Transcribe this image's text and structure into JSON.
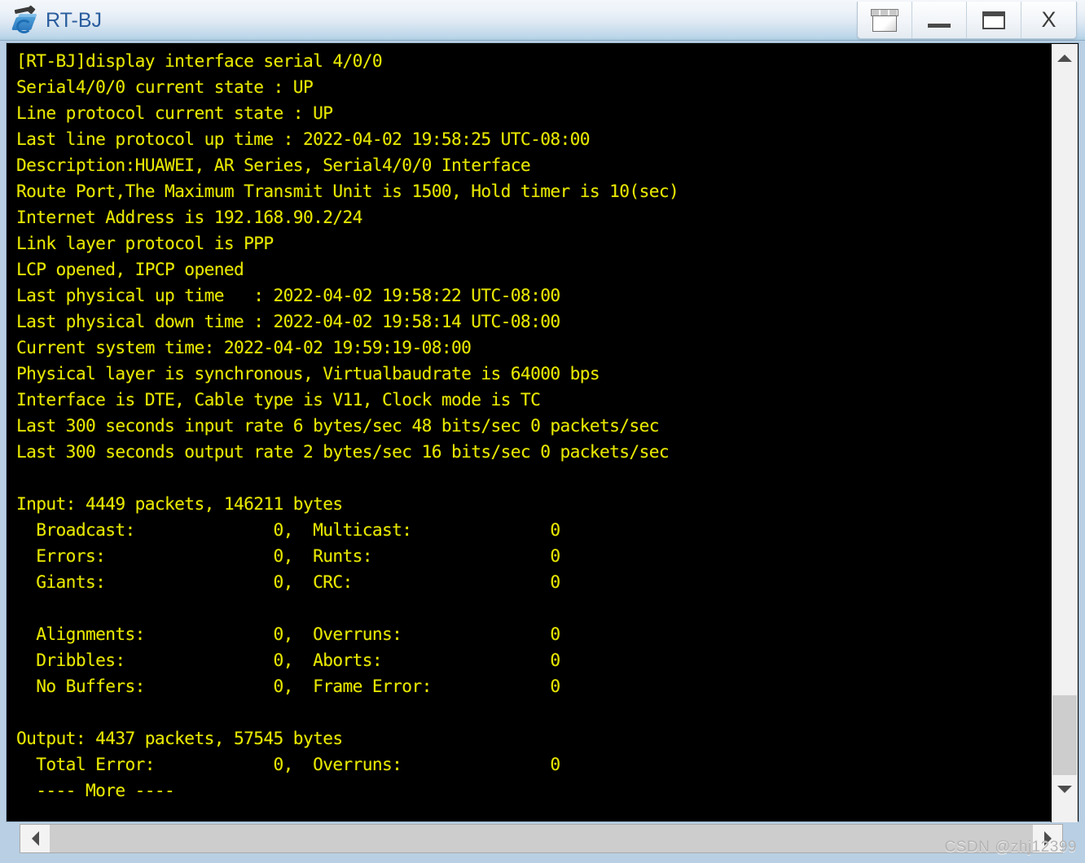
{
  "window": {
    "title": "RT-BJ",
    "icon": "router-icon",
    "controls": [
      {
        "name": "restore-button",
        "glyph": "restore-icon",
        "label": "Restore"
      },
      {
        "name": "minimize-button",
        "glyph": "minimize-icon",
        "label": "Minimize"
      },
      {
        "name": "maximize-button",
        "glyph": "maximize-icon",
        "label": "Maximize"
      },
      {
        "name": "close-button",
        "glyph": "close-icon",
        "label": "X"
      }
    ],
    "accent_color": "#2a5d9e",
    "titlebar_color": "#dfe9f3",
    "frame_color": "#b9cfe3"
  },
  "terminal": {
    "background_color": "#000000",
    "text_color": "#e8e800",
    "prompt": "[RT-BJ]",
    "command": "display interface serial 4/0/0",
    "content": "[RT-BJ]display interface serial 4/0/0\nSerial4/0/0 current state : UP\nLine protocol current state : UP\nLast line protocol up time : 2022-04-02 19:58:25 UTC-08:00\nDescription:HUAWEI, AR Series, Serial4/0/0 Interface\nRoute Port,The Maximum Transmit Unit is 1500, Hold timer is 10(sec)\nInternet Address is 192.168.90.2/24\nLink layer protocol is PPP\nLCP opened, IPCP opened\nLast physical up time   : 2022-04-02 19:58:22 UTC-08:00\nLast physical down time : 2022-04-02 19:58:14 UTC-08:00\nCurrent system time: 2022-04-02 19:59:19-08:00\nPhysical layer is synchronous, Virtualbaudrate is 64000 bps\nInterface is DTE, Cable type is V11, Clock mode is TC\nLast 300 seconds input rate 6 bytes/sec 48 bits/sec 0 packets/sec\nLast 300 seconds output rate 2 bytes/sec 16 bits/sec 0 packets/sec\n\nInput: 4449 packets, 146211 bytes\n  Broadcast:              0,  Multicast:              0\n  Errors:                 0,  Runts:                  0\n  Giants:                 0,  CRC:                    0\n\n  Alignments:             0,  Overruns:               0\n  Dribbles:               0,  Aborts:                 0\n  No Buffers:             0,  Frame Error:            0\n\nOutput: 4437 packets, 57545 bytes\n  Total Error:            0,  Overruns:               0\n  ---- More ----",
    "lines": [
      "[RT-BJ]display interface serial 4/0/0",
      "Serial4/0/0 current state : UP",
      "Line protocol current state : UP",
      "Last line protocol up time : 2022-04-02 19:58:25 UTC-08:00",
      "Description:HUAWEI, AR Series, Serial4/0/0 Interface",
      "Route Port,The Maximum Transmit Unit is 1500, Hold timer is 10(sec)",
      "Internet Address is 192.168.90.2/24",
      "Link layer protocol is PPP",
      "LCP opened, IPCP opened",
      "Last physical up time   : 2022-04-02 19:58:22 UTC-08:00",
      "Last physical down time : 2022-04-02 19:58:14 UTC-08:00",
      "Current system time: 2022-04-02 19:59:19-08:00",
      "Physical layer is synchronous, Virtualbaudrate is 64000 bps",
      "Interface is DTE, Cable type is V11, Clock mode is TC",
      "Last 300 seconds input rate 6 bytes/sec 48 bits/sec 0 packets/sec",
      "Last 300 seconds output rate 2 bytes/sec 16 bits/sec 0 packets/sec",
      "",
      "Input: 4449 packets, 146211 bytes",
      "  Broadcast:              0,  Multicast:              0",
      "  Errors:                 0,  Runts:                  0",
      "  Giants:                 0,  CRC:                    0",
      "",
      "  Alignments:             0,  Overruns:               0",
      "  Dribbles:               0,  Aborts:                 0",
      "  No Buffers:             0,  Frame Error:            0",
      "",
      "Output: 4437 packets, 57545 bytes",
      "  Total Error:            0,  Overruns:               0",
      "  ---- More ----"
    ],
    "interface": {
      "name": "Serial4/0/0",
      "current_state": "UP",
      "line_protocol_state": "UP",
      "last_line_protocol_up_time": "2022-04-02 19:58:25 UTC-08:00",
      "description": "HUAWEI, AR Series, Serial4/0/0 Interface",
      "port_type": "Route Port",
      "mtu": "1500",
      "hold_timer": "10(sec)",
      "internet_address": "192.168.90.2/24",
      "link_layer_protocol": "PPP",
      "lcp_state": "opened",
      "ipcp_state": "opened",
      "last_physical_up_time": "2022-04-02 19:58:22 UTC-08:00",
      "last_physical_down_time": "2022-04-02 19:58:14 UTC-08:00",
      "current_system_time": "2022-04-02 19:59:19-08:00",
      "physical_layer": "synchronous",
      "virtual_baudrate": "64000 bps",
      "dte_dce": "DTE",
      "cable_type": "V11",
      "clock_mode": "TC",
      "input_rate": "6 bytes/sec 48 bits/sec 0 packets/sec",
      "output_rate": "2 bytes/sec 16 bits/sec 0 packets/sec",
      "input_packets": "4449",
      "input_bytes": "146211",
      "output_packets": "4437",
      "output_bytes": "57545",
      "input_counters": [
        {
          "label": "Broadcast:",
          "value": "0",
          "label2": "Multicast:",
          "value2": "0"
        },
        {
          "label": "Errors:",
          "value": "0",
          "label2": "Runts:",
          "value2": "0"
        },
        {
          "label": "Giants:",
          "value": "0",
          "label2": "CRC:",
          "value2": "0"
        },
        {
          "label": "Alignments:",
          "value": "0",
          "label2": "Overruns:",
          "value2": "0"
        },
        {
          "label": "Dribbles:",
          "value": "0",
          "label2": "Aborts:",
          "value2": "0"
        },
        {
          "label": "No Buffers:",
          "value": "0",
          "label2": "Frame Error:",
          "value2": "0"
        }
      ],
      "output_counters": [
        {
          "label": "Total Error:",
          "value": "0",
          "label2": "Overruns:",
          "value2": "0"
        }
      ]
    },
    "pager_prompt": "  ---- More ----"
  },
  "scrollbars": {
    "vertical": {
      "up_arrow": "chevron-up-icon",
      "down_arrow": "chevron-down-icon"
    },
    "horizontal": {
      "left_arrow": "chevron-left-icon",
      "right_arrow": "chevron-right-icon"
    }
  },
  "watermark": {
    "text": "CSDN @zhj12399"
  }
}
